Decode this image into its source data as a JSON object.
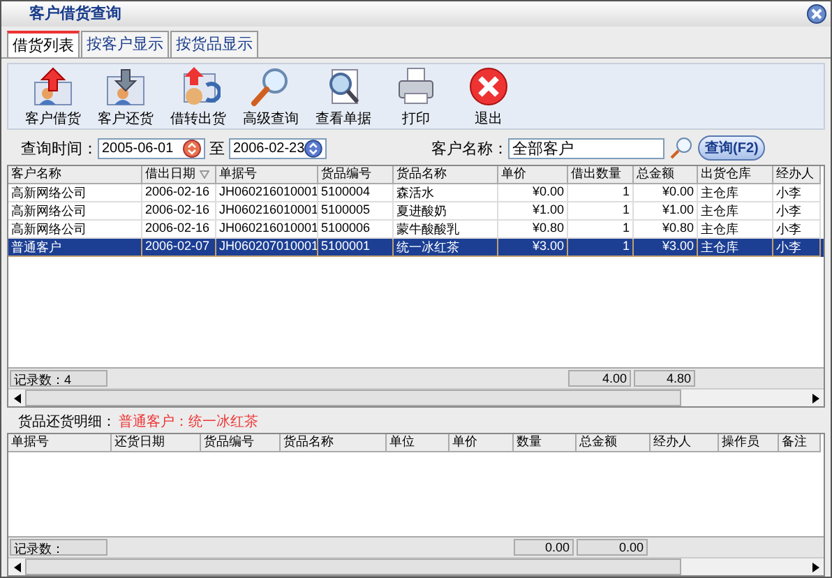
{
  "window": {
    "title": "客户借货查询"
  },
  "tabs": [
    {
      "label": "借货列表",
      "selected": true
    },
    {
      "label": "按客户显示",
      "selected": false
    },
    {
      "label": "按货品显示",
      "selected": false
    }
  ],
  "toolbar": [
    "客户借货",
    "客户还货",
    "借转出货",
    "高级查询",
    "查看单据",
    "打印",
    "退出"
  ],
  "query": {
    "time_label": "查询时间：",
    "from": "2005-06-01",
    "to_label": "至",
    "to": "2006-02-23",
    "customer_label": "客户名称：",
    "customer": "全部客户",
    "button": "查询(F2)"
  },
  "table": {
    "columns": [
      "客户名称",
      "借出日期",
      "单据号",
      "货品编号",
      "货品名称",
      "单价",
      "借出数量",
      "总金额",
      "出货仓库",
      "经办人"
    ],
    "rows": [
      {
        "cells": [
          "高新网络公司",
          "2006-02-16",
          "JH060216010001",
          "5100004",
          "森活水",
          "¥0.00",
          "1",
          "¥0.00",
          "主仓库",
          "小李"
        ],
        "selected": false
      },
      {
        "cells": [
          "高新网络公司",
          "2006-02-16",
          "JH060216010001",
          "5100005",
          "夏进酸奶",
          "¥1.00",
          "1",
          "¥1.00",
          "主仓库",
          "小李"
        ],
        "selected": false
      },
      {
        "cells": [
          "高新网络公司",
          "2006-02-16",
          "JH060216010001",
          "5100006",
          "蒙牛酸酸乳",
          "¥0.80",
          "1",
          "¥0.80",
          "主仓库",
          "小李"
        ],
        "selected": false
      },
      {
        "cells": [
          "普通客户",
          "2006-02-07",
          "JH060207010001",
          "5100001",
          "统一冰红茶",
          "¥3.00",
          "1",
          "¥3.00",
          "主仓库",
          "小李"
        ],
        "selected": true
      }
    ],
    "record_count": "记录数：4",
    "totals": [
      "4.00",
      "4.80"
    ]
  },
  "detail": {
    "label": "货品还货明细：",
    "subject": "普通客户：统一冰红茶",
    "columns": [
      "单据号",
      "还货日期",
      "货品编号",
      "货品名称",
      "单位",
      "单价",
      "数量",
      "总金额",
      "经办人",
      "操作员",
      "备注"
    ],
    "record_count": "记录数：",
    "totals": [
      "0.00",
      "0.00"
    ]
  }
}
